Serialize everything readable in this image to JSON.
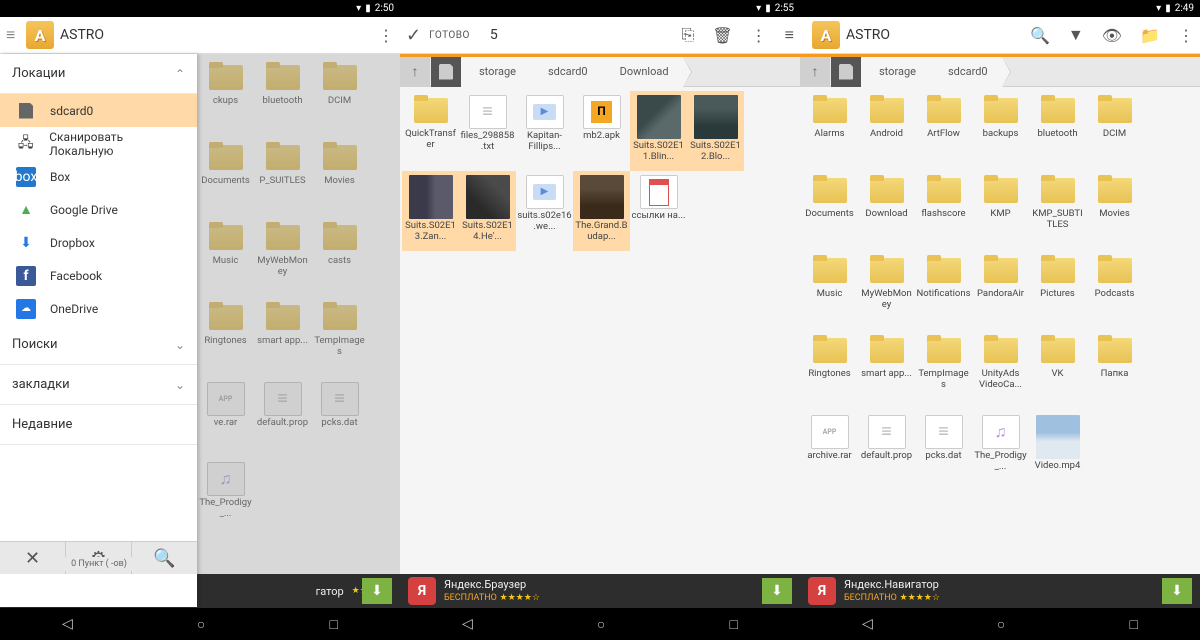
{
  "status": {
    "time1": "2:50",
    "time2": "2:55",
    "time3": "2:49"
  },
  "app": {
    "name": "ASTRO"
  },
  "pane1": {
    "sidebar": {
      "locations": "Локации",
      "items": [
        {
          "icon": "sd",
          "label": "sdcard0"
        },
        {
          "icon": "net",
          "label": "Сканировать Локальную"
        },
        {
          "icon": "box",
          "label": "Box"
        },
        {
          "icon": "gd",
          "label": "Google Drive"
        },
        {
          "icon": "db",
          "label": "Dropbox"
        },
        {
          "icon": "fb",
          "label": "Facebook"
        },
        {
          "icon": "od",
          "label": "OneDrive"
        }
      ],
      "search": "Поиски",
      "bookmarks": "закладки",
      "recent": "Недавние"
    },
    "bg_items": [
      "ckups",
      "bluetooth",
      "DCIM",
      "Documents",
      "P_SUITLES",
      "Movies",
      "Music",
      "MyWebMoney",
      "casts",
      "Ringtones",
      "smart app...",
      "TempImages",
      "ve.rar",
      "default.prop",
      "pcks.dat",
      "The_Prodigy_..."
    ],
    "bottom_text": "0 Пункт ( -ов)"
  },
  "pane2": {
    "titlebar": {
      "ready": "ГОТОВО",
      "count": "5"
    },
    "path": [
      "storage",
      "sdcard0",
      "Download"
    ],
    "items": [
      {
        "type": "folder",
        "label": "QuickTransfer"
      },
      {
        "type": "txt",
        "label": "files_298858.txt"
      },
      {
        "type": "video",
        "label": "Kapitan-Fillips..."
      },
      {
        "type": "apk",
        "label": "mb2.apk"
      },
      {
        "type": "thumb",
        "tc": "t1",
        "label": "Suits.S02E11.Blin...",
        "sel": true
      },
      {
        "type": "thumb",
        "tc": "t2",
        "label": "Suits.S02E12.Blo...",
        "sel": true
      },
      {
        "type": "thumb",
        "tc": "t3",
        "label": "Suits.S02E13.Zan...",
        "sel": true
      },
      {
        "type": "thumb",
        "tc": "t4",
        "label": "Suits.S02E14.He'...",
        "sel": true
      },
      {
        "type": "video",
        "label": "suits.s02e16.we..."
      },
      {
        "type": "thumb",
        "tc": "t5",
        "label": "The.Grand.Budap...",
        "sel": true
      },
      {
        "type": "pdf",
        "label": "ссылки на..."
      }
    ],
    "ad": {
      "title": "Яндекс.Браузер",
      "free": "БЕСПЛАТНО"
    }
  },
  "pane3": {
    "path": [
      "storage",
      "sdcard0"
    ],
    "items": [
      {
        "type": "folder",
        "label": "Alarms"
      },
      {
        "type": "folder",
        "label": "Android"
      },
      {
        "type": "folder",
        "label": "ArtFlow"
      },
      {
        "type": "folder",
        "label": "backups"
      },
      {
        "type": "folder",
        "label": "bluetooth"
      },
      {
        "type": "folder",
        "label": "DCIM"
      },
      {
        "type": "folder",
        "label": "Documents"
      },
      {
        "type": "folder",
        "label": "Download"
      },
      {
        "type": "folder",
        "label": "flashscore"
      },
      {
        "type": "folder",
        "label": "KMP"
      },
      {
        "type": "folder",
        "label": "KMP_SUBTITLES"
      },
      {
        "type": "folder",
        "label": "Movies"
      },
      {
        "type": "folder",
        "label": "Music"
      },
      {
        "type": "folder",
        "label": "MyWebMoney"
      },
      {
        "type": "folder",
        "label": "Notifications"
      },
      {
        "type": "folder",
        "label": "PandoraAir"
      },
      {
        "type": "folder",
        "label": "Pictures"
      },
      {
        "type": "folder",
        "label": "Podcasts"
      },
      {
        "type": "folder",
        "label": "Ringtones"
      },
      {
        "type": "folder",
        "label": "smart app..."
      },
      {
        "type": "folder",
        "label": "TempImages"
      },
      {
        "type": "folder",
        "label": "UnityAds VideoCa..."
      },
      {
        "type": "folder",
        "label": "VK"
      },
      {
        "type": "folder",
        "label": "Папка"
      },
      {
        "type": "app",
        "label": "archive.rar"
      },
      {
        "type": "txt",
        "label": "default.prop"
      },
      {
        "type": "txt",
        "label": "pcks.dat"
      },
      {
        "type": "music",
        "label": "The_Prodigy_..."
      },
      {
        "type": "thumb",
        "tc": "t6",
        "label": "Video.mp4"
      }
    ],
    "ad": {
      "title": "Яндекс.Навигатор",
      "free": "БЕСПЛАТНО"
    }
  },
  "pane1_ad": {
    "text": "гатор"
  }
}
